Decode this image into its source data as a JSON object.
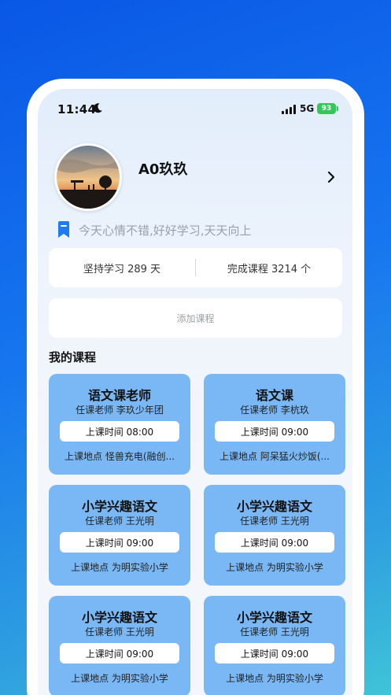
{
  "status_bar": {
    "time": "11:44",
    "network": "5G",
    "battery": "93",
    "icons": [
      "moon-icon",
      "signal-icon",
      "battery-icon"
    ],
    "battery_color": "#34c759"
  },
  "profile": {
    "name": "A0玖玖",
    "motto": "今天心情不错,好好学习,天天向上",
    "icons": [
      "avatar",
      "chevron-right-icon",
      "bookmark-icon"
    ]
  },
  "stats": {
    "study_days": "坚持学习 289 天",
    "completed": "完成课程 3214 个"
  },
  "add_course_label": "添加课程",
  "section_title": "我的课程",
  "colors": {
    "card_blue": "#7ab8f5",
    "accent": "#1e7bf2",
    "background_top": "#0a57e6"
  },
  "courses": [
    {
      "name": "语文课老师",
      "teacher": "任课老师  李玖少年团",
      "time": "上课时间  08:00",
      "place": "上课地点  怪兽充电(融创..."
    },
    {
      "name": "语文课",
      "teacher": "任课老师  李杭玖",
      "time": "上课时间  09:00",
      "place": "上课地点  阿呆猛火炒饭(..."
    },
    {
      "name": "小学兴趣语文",
      "teacher": "任课老师  王光明",
      "time": "上课时间  09:00",
      "place": "上课地点  为明实验小学"
    },
    {
      "name": "小学兴趣语文",
      "teacher": "任课老师  王光明",
      "time": "上课时间  09:00",
      "place": "上课地点  为明实验小学"
    },
    {
      "name": "小学兴趣语文",
      "teacher": "任课老师  王光明",
      "time": "上课时间  09:00",
      "place": "上课地点  为明实验小学"
    },
    {
      "name": "小学兴趣语文",
      "teacher": "任课老师  王光明",
      "time": "上课时间  09:00",
      "place": "上课地点  为明实验小学"
    }
  ]
}
